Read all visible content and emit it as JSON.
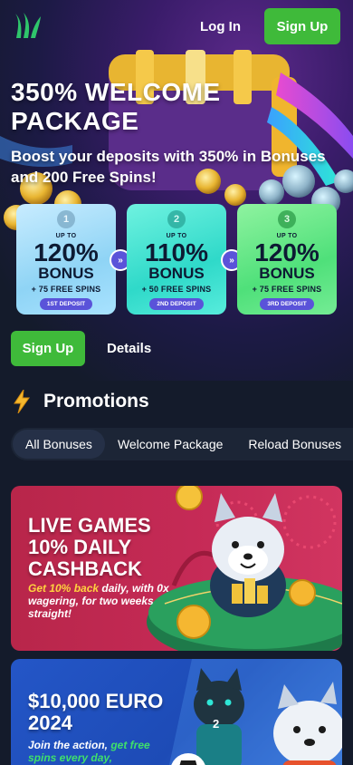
{
  "header": {
    "login_label": "Log In",
    "signup_label": "Sign Up"
  },
  "hero": {
    "title": "350% WELCOME PACKAGE",
    "subtitle": "Boost your deposits with 350% in Bonuses and 200 Free Spins!",
    "deposits": [
      {
        "number": "1",
        "upto": "UP TO",
        "percent": "120%",
        "bonus": "BONUS",
        "spins": "+ 75 FREE SPINS",
        "tag": "1ST DEPOSIT"
      },
      {
        "number": "2",
        "upto": "UP TO",
        "percent": "110%",
        "bonus": "BONUS",
        "spins": "+ 50 FREE SPINS",
        "tag": "2ND DEPOSIT"
      },
      {
        "number": "3",
        "upto": "UP TO",
        "percent": "120%",
        "bonus": "BONUS",
        "spins": "+ 75 FREE SPINS",
        "tag": "3RD DEPOSIT"
      }
    ],
    "arrow_glyph": "»",
    "signup_label": "Sign Up",
    "details_label": "Details"
  },
  "promotions": {
    "title": "Promotions",
    "filters": [
      "All Bonuses",
      "Welcome Package",
      "Reload Bonuses"
    ],
    "active_filter": "All Bonuses",
    "cards": [
      {
        "title": "LIVE GAMES 10% DAILY CASHBACK",
        "desc_highlight": "Get 10% back",
        "desc_rest": " daily, with 0x wagering, for two weeks straight!"
      },
      {
        "title": "$10,000 EURO 2024",
        "desc_lead": "Join the action, ",
        "desc_highlight": "get free spins every day,",
        "jersey_number": "2"
      }
    ]
  },
  "colors": {
    "accent_green": "#3fba3a",
    "page_bg": "#141b2b",
    "card1_bg": "#c52a56",
    "card2_bg": "#1d4bb6",
    "highlight_yellow": "#ffd23f"
  }
}
